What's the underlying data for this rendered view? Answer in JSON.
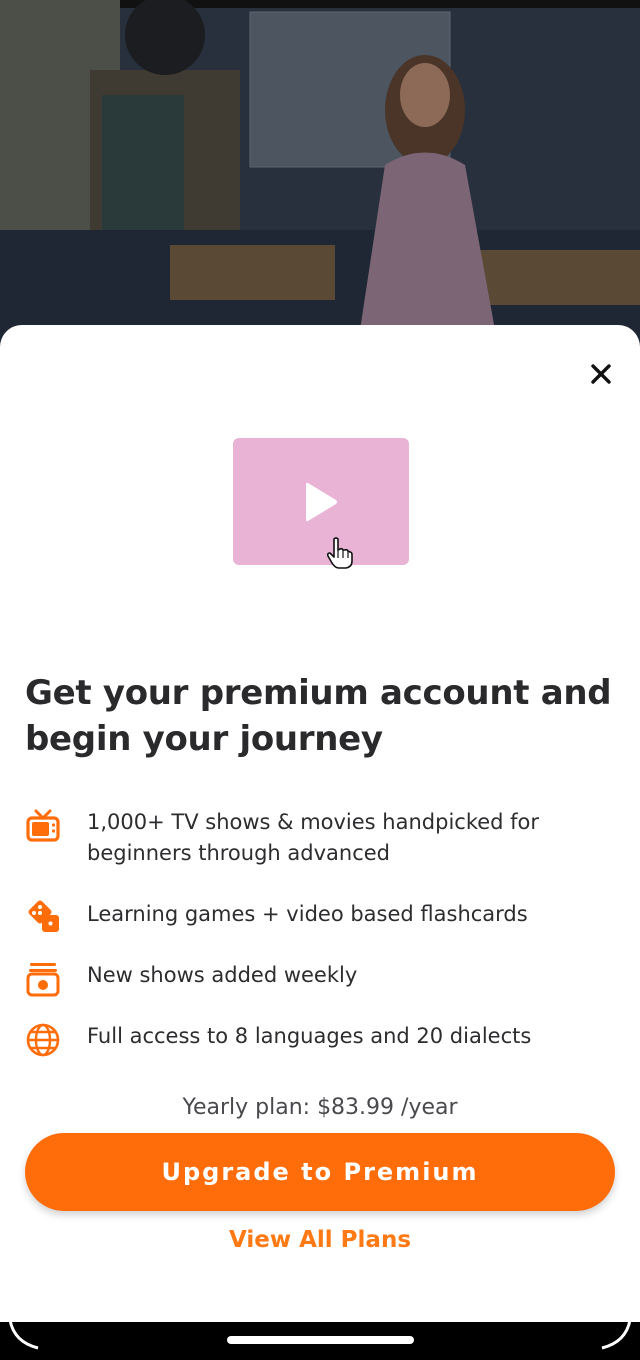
{
  "sheet": {
    "headline": "Get your premium account and begin your journey",
    "features": [
      {
        "icon": "tv-icon",
        "text": "1,000+ TV shows & movies handpicked for beginners through advanced"
      },
      {
        "icon": "dice-icon",
        "text": "Learning games + video based flashcards"
      },
      {
        "icon": "calendar-icon",
        "text": "New shows added weekly"
      },
      {
        "icon": "globe-icon",
        "text": "Full access to 8 languages and 20 dialects"
      }
    ],
    "plan_text": "Yearly plan: $83.99 /year",
    "upgrade_label": "Upgrade to Premium",
    "view_plans_label": "View All Plans"
  },
  "colors": {
    "accent": "#ff6d0a",
    "link": "#ff7a14",
    "thumb": "#e8b3d5",
    "text": "#2a2a2c"
  }
}
